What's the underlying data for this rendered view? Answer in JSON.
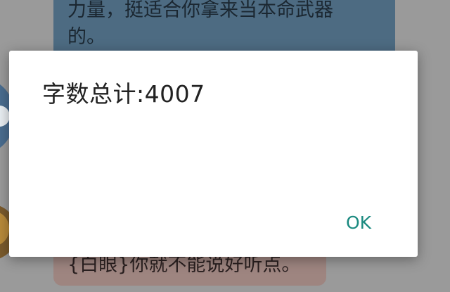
{
  "chat": {
    "top_message_lines": [
      "力量，挺适合你拿来当本命武器",
      "的。"
    ],
    "bottom_message": "{白眼}你就不能说好听点。"
  },
  "dialog": {
    "message": "字数总计:4007",
    "ok_label": "OK"
  },
  "colors": {
    "overlay_background": "#9a9a9a",
    "top_bubble": "#4d6b82",
    "bottom_bubble": "#9e8580",
    "dialog_background": "#ffffff",
    "button_text": "#1b8a80"
  }
}
